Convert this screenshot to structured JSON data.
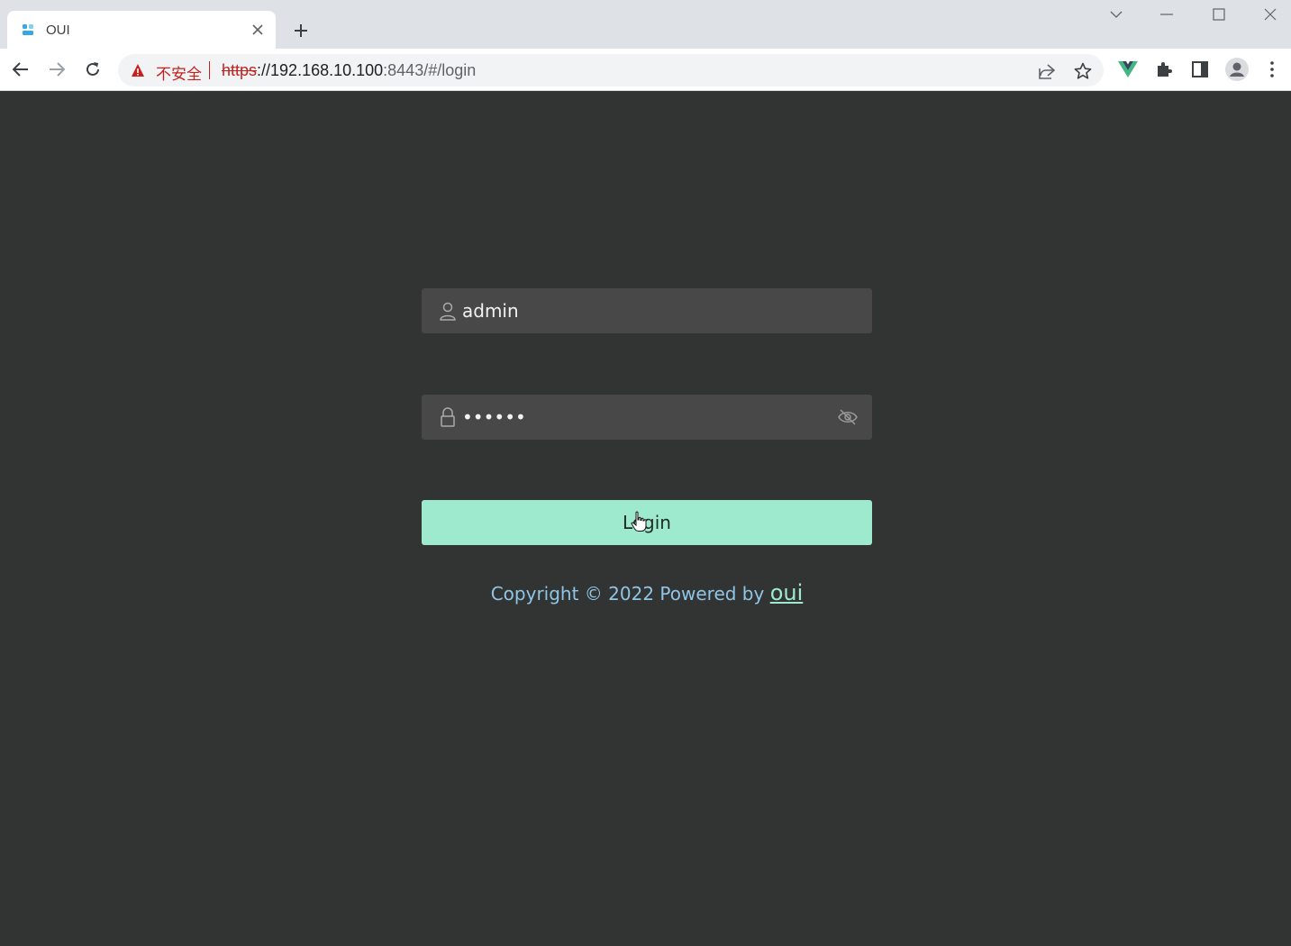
{
  "browser": {
    "tab_title": "OUI",
    "security_label": "不安全",
    "url_scheme": "https",
    "url_host": "://192.168.10.100",
    "url_rest": ":8443/#/login"
  },
  "login": {
    "username_value": "admin",
    "password_value": "••••••",
    "button_label": "Login"
  },
  "footer": {
    "copyright_text": "Copyright © 2022 Powered by ",
    "brand_link": "oui"
  },
  "colors": {
    "background": "#323333",
    "input_bg": "#484848",
    "accent": "#9deacf",
    "copyright": "#8fc6e6"
  }
}
